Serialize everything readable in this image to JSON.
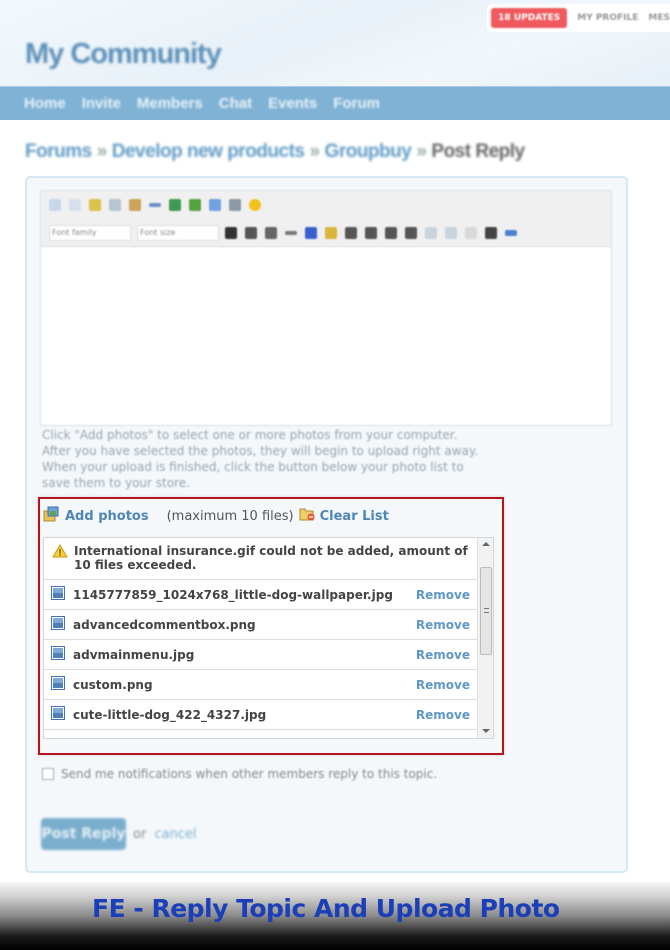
{
  "topbar": {
    "updates_badge": "18 UPDATES",
    "links": [
      "MY PROFILE",
      "MES"
    ]
  },
  "site": {
    "title": "My Community"
  },
  "nav": {
    "items": [
      "Home",
      "Invite",
      "Members",
      "Chat",
      "Events",
      "Forum"
    ]
  },
  "breadcrumb": {
    "items": [
      "Forums",
      "Develop new products",
      "Groupbuy"
    ],
    "separator": "»",
    "current": "Post Reply"
  },
  "editor": {
    "font_family_placeholder": "Font family",
    "font_size_placeholder": "Font size",
    "content": ""
  },
  "upload_hint": "Click \"Add photos\" to select one or more photos from your computer. After you have selected the photos, they will begin to upload right away. When your upload is finished, click the button below your photo list to save them to your store.",
  "uploader": {
    "add_photos_label": "Add photos",
    "max_files_text": "(maximum 10 files)",
    "clear_list_label": "Clear List",
    "warning": "International insurance.gif could not be added, amount of 10 files exceeded.",
    "remove_label": "Remove",
    "files": [
      "1145777859_1024x768_little-dog-wallpaper.jpg",
      "advancedcommentbox.png",
      "advmainmenu.jpg",
      "custom.png",
      "cute-little-dog_422_4327.jpg"
    ]
  },
  "notifications": {
    "label": "Send me notifications when other members reply to this topic.",
    "checked": false
  },
  "actions": {
    "post_reply_label": "Post Reply",
    "or_text": "or",
    "cancel_label": "cancel"
  },
  "banner": {
    "caption": "FE - Reply Topic And Upload Photo"
  },
  "colors": {
    "accent": "#5f9bc6",
    "nav_bar": "#7fb2d5",
    "updates_badge": "#f05a5f",
    "highlight_border": "#b8121b",
    "banner_text": "#1b3fb8"
  }
}
